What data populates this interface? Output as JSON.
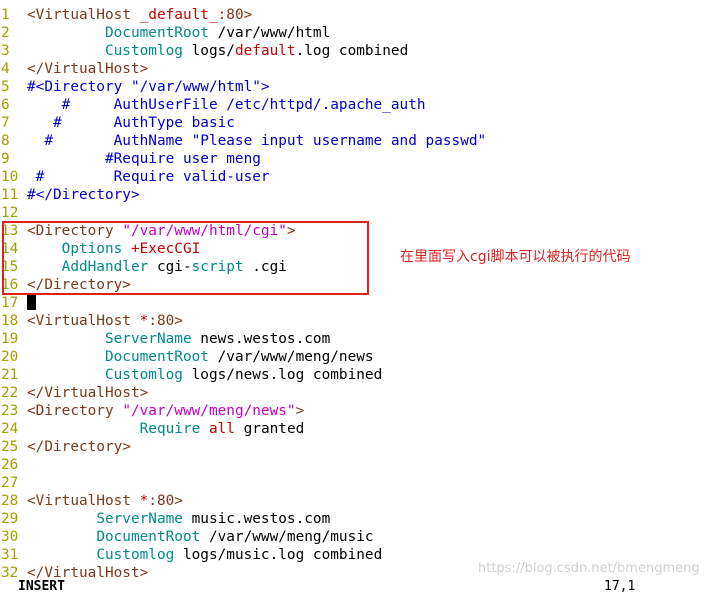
{
  "editor": {
    "mode": "INSERT",
    "position": "17,1",
    "cursor_line": 17
  },
  "lines": [
    {
      "num": "1",
      "segs": [
        {
          "t": "<VirtualHost ",
          "c": "tag"
        },
        {
          "t": "_default_",
          "c": "lit"
        },
        {
          "t": ":80>",
          "c": "tag"
        }
      ]
    },
    {
      "num": "2",
      "segs": [
        {
          "t": "         "
        },
        {
          "t": "DocumentRoot",
          "c": "kw"
        },
        {
          "t": " /var/www/html"
        }
      ]
    },
    {
      "num": "3",
      "segs": [
        {
          "t": "         "
        },
        {
          "t": "Customlog",
          "c": "kw"
        },
        {
          "t": " logs/"
        },
        {
          "t": "default",
          "c": "lit"
        },
        {
          "t": ".log combined"
        }
      ]
    },
    {
      "num": "4",
      "segs": [
        {
          "t": "</VirtualHost>",
          "c": "tag"
        }
      ]
    },
    {
      "num": "5",
      "segs": [
        {
          "t": "#<Directory \"/var/www/html\">",
          "c": "cmt"
        }
      ]
    },
    {
      "num": "6",
      "segs": [
        {
          "t": "    #     AuthUserFile /etc/httpd/.apache_auth",
          "c": "cmt"
        }
      ]
    },
    {
      "num": "7",
      "segs": [
        {
          "t": "   #      AuthType basic",
          "c": "cmt"
        }
      ]
    },
    {
      "num": "8",
      "segs": [
        {
          "t": "  #       AuthName \"Please input username and passwd\"",
          "c": "cmt"
        }
      ]
    },
    {
      "num": "9",
      "segs": [
        {
          "t": "         #Require user meng",
          "c": "cmt"
        }
      ]
    },
    {
      "num": "10",
      "segs": [
        {
          "t": " #        Require valid-user",
          "c": "cmt"
        }
      ]
    },
    {
      "num": "11",
      "segs": [
        {
          "t": "#</Directory>",
          "c": "cmt"
        }
      ]
    },
    {
      "num": "12",
      "segs": []
    },
    {
      "num": "13",
      "segs": [
        {
          "t": "<Directory ",
          "c": "tag"
        },
        {
          "t": "\"/var/www/html/cgi\"",
          "c": "str"
        },
        {
          "t": ">",
          "c": "tag"
        }
      ]
    },
    {
      "num": "14",
      "segs": [
        {
          "t": "    "
        },
        {
          "t": "Options",
          "c": "kw"
        },
        {
          "t": " "
        },
        {
          "t": "+ExecCGI",
          "c": "lit"
        }
      ]
    },
    {
      "num": "15",
      "segs": [
        {
          "t": "    "
        },
        {
          "t": "AddHandler",
          "c": "kw"
        },
        {
          "t": " cgi-"
        },
        {
          "t": "script",
          "c": "kw"
        },
        {
          "t": " .cgi"
        }
      ]
    },
    {
      "num": "16",
      "segs": [
        {
          "t": "</Directory>",
          "c": "tag"
        }
      ]
    },
    {
      "num": "17",
      "segs": []
    },
    {
      "num": "18",
      "segs": [
        {
          "t": "<VirtualHost ",
          "c": "tag"
        },
        {
          "t": "*",
          "c": "lit"
        },
        {
          "t": ":80>",
          "c": "tag"
        }
      ]
    },
    {
      "num": "19",
      "segs": [
        {
          "t": "         "
        },
        {
          "t": "ServerName",
          "c": "kw"
        },
        {
          "t": " news.westos.com"
        }
      ]
    },
    {
      "num": "20",
      "segs": [
        {
          "t": "         "
        },
        {
          "t": "DocumentRoot",
          "c": "kw"
        },
        {
          "t": " /var/www/meng/news"
        }
      ]
    },
    {
      "num": "21",
      "segs": [
        {
          "t": "         "
        },
        {
          "t": "Customlog",
          "c": "kw"
        },
        {
          "t": " logs/news.log combined"
        }
      ]
    },
    {
      "num": "22",
      "segs": [
        {
          "t": "</VirtualHost>",
          "c": "tag"
        }
      ]
    },
    {
      "num": "23",
      "segs": [
        {
          "t": "<Directory ",
          "c": "tag"
        },
        {
          "t": "\"/var/www/meng/news\"",
          "c": "str"
        },
        {
          "t": ">",
          "c": "tag"
        }
      ]
    },
    {
      "num": "24",
      "segs": [
        {
          "t": "             "
        },
        {
          "t": "Require",
          "c": "kw"
        },
        {
          "t": " "
        },
        {
          "t": "all",
          "c": "lit"
        },
        {
          "t": " granted"
        }
      ]
    },
    {
      "num": "25",
      "segs": [
        {
          "t": "</Directory>",
          "c": "tag"
        }
      ]
    },
    {
      "num": "26",
      "segs": []
    },
    {
      "num": "27",
      "segs": []
    },
    {
      "num": "28",
      "segs": [
        {
          "t": "<VirtualHost ",
          "c": "tag"
        },
        {
          "t": "*",
          "c": "lit"
        },
        {
          "t": ":80>",
          "c": "tag"
        }
      ]
    },
    {
      "num": "29",
      "segs": [
        {
          "t": "        "
        },
        {
          "t": "ServerName",
          "c": "kw"
        },
        {
          "t": " music.westos.com"
        }
      ]
    },
    {
      "num": "30",
      "segs": [
        {
          "t": "        "
        },
        {
          "t": "DocumentRoot",
          "c": "kw"
        },
        {
          "t": " /var/www/meng/music"
        }
      ]
    },
    {
      "num": "31",
      "segs": [
        {
          "t": "        "
        },
        {
          "t": "Customlog",
          "c": "kw"
        },
        {
          "t": " logs/music.log combined"
        }
      ]
    },
    {
      "num": "32",
      "segs": [
        {
          "t": "</VirtualHost>",
          "c": "tag"
        }
      ]
    }
  ],
  "annotation": {
    "text": "在里面写入cgi脚本可以被执行的代码",
    "color": "#e02020"
  },
  "watermark": "https://blog.csdn.net/bmengmeng",
  "colors": {
    "line_number": "#a0a000",
    "tag": "#7a3a1a",
    "keyword": "#008a8a",
    "string": "#c400c4",
    "literal": "#c40000",
    "comment": "#0000c8"
  }
}
